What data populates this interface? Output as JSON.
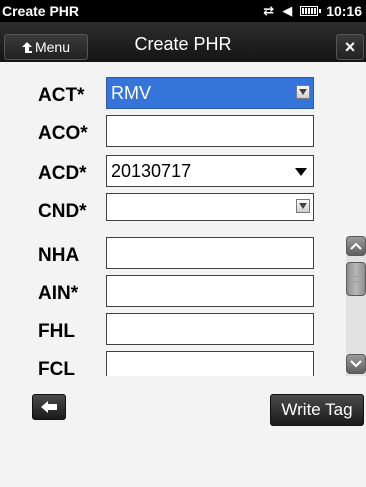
{
  "status_bar": {
    "title": "Create PHR",
    "time": "10:16",
    "icons": [
      "connectivity-icon",
      "volume-icon",
      "battery-icon"
    ]
  },
  "header": {
    "menu_label": "Menu",
    "title": "Create PHR",
    "close_label": "×"
  },
  "form": {
    "fields": [
      {
        "label": "ACT*",
        "value": "RMV",
        "type": "dropdown",
        "selected": true
      },
      {
        "label": "ACO*",
        "value": "",
        "type": "text"
      },
      {
        "label": "ACD*",
        "value": "20130717",
        "type": "date-dropdown"
      },
      {
        "label": "CND*",
        "value": "",
        "type": "dropdown"
      },
      {
        "label": "NHA",
        "value": "",
        "type": "text"
      },
      {
        "label": "AIN*",
        "value": "",
        "type": "text"
      },
      {
        "label": "FHL",
        "value": "",
        "type": "text"
      },
      {
        "label": "FCL",
        "value": "",
        "type": "text"
      }
    ]
  },
  "buttons": {
    "write_tag": "Write Tag"
  },
  "colors": {
    "selection": "#3574d8",
    "header": "#1e1e1e",
    "background": "#f3f3f3"
  }
}
